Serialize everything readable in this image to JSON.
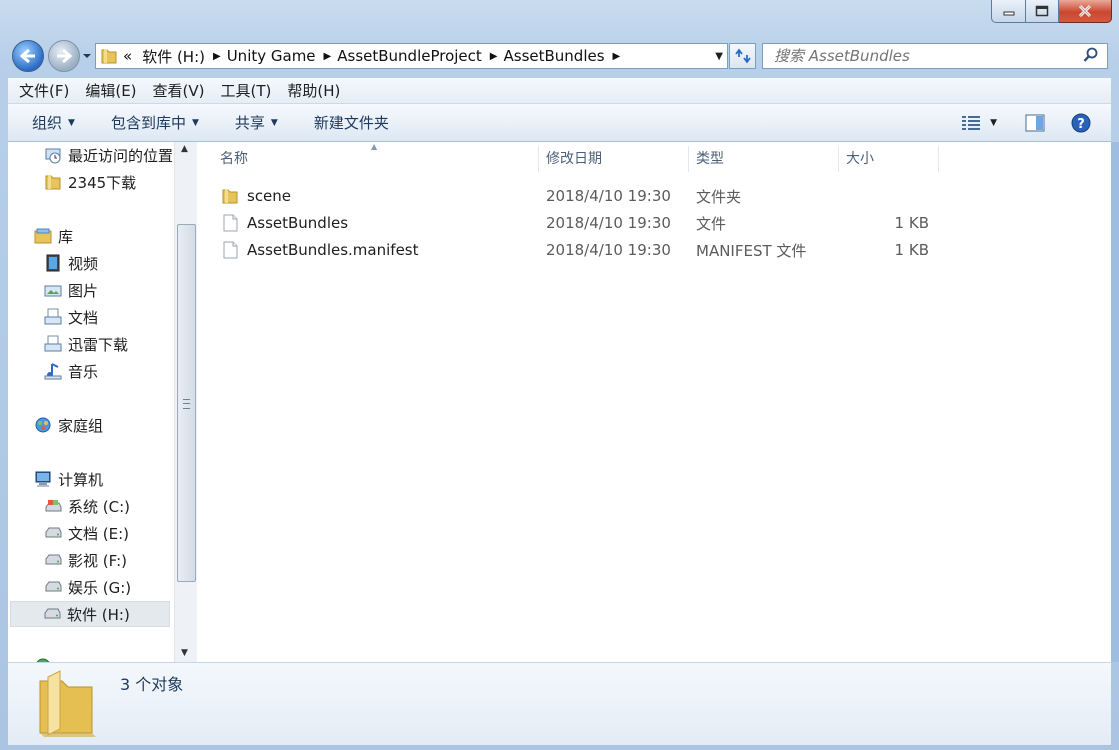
{
  "address": {
    "overflow": "«",
    "crumbs": [
      "软件 (H:)",
      "Unity Game",
      "AssetBundleProject",
      "AssetBundles"
    ]
  },
  "search": {
    "placeholder": "搜索 AssetBundles"
  },
  "menu": [
    "文件(F)",
    "编辑(E)",
    "查看(V)",
    "工具(T)",
    "帮助(H)"
  ],
  "toolbar": {
    "organize": "组织",
    "include": "包含到库中",
    "share": "共享",
    "new_folder": "新建文件夹"
  },
  "nav": {
    "recent": "最近访问的位置",
    "dl2345": "2345下载",
    "library": "库",
    "videos": "视频",
    "pictures": "图片",
    "documents": "文档",
    "xunlei": "迅雷下载",
    "music": "音乐",
    "homegroup": "家庭组",
    "computer": "计算机",
    "drive_c": "系统 (C:)",
    "drive_e": "文档 (E:)",
    "drive_f": "影视 (F:)",
    "drive_g": "娱乐 (G:)",
    "drive_h": "软件 (H:)"
  },
  "columns": {
    "name": "名称",
    "modified": "修改日期",
    "type": "类型",
    "size": "大小"
  },
  "files": [
    {
      "name": "scene",
      "modified": "2018/4/10 19:30",
      "type": "文件夹",
      "size": "",
      "icon": "folder-icon"
    },
    {
      "name": "AssetBundles",
      "modified": "2018/4/10 19:30",
      "type": "文件",
      "size": "1 KB",
      "icon": "file-icon"
    },
    {
      "name": "AssetBundles.manifest",
      "modified": "2018/4/10 19:30",
      "type": "MANIFEST 文件",
      "size": "1 KB",
      "icon": "file-icon"
    }
  ],
  "status": {
    "count": "3 个对象"
  },
  "colors": {
    "accent": "#1e395b",
    "frame": "#b7cfe8",
    "header_text": "#4c607a"
  }
}
